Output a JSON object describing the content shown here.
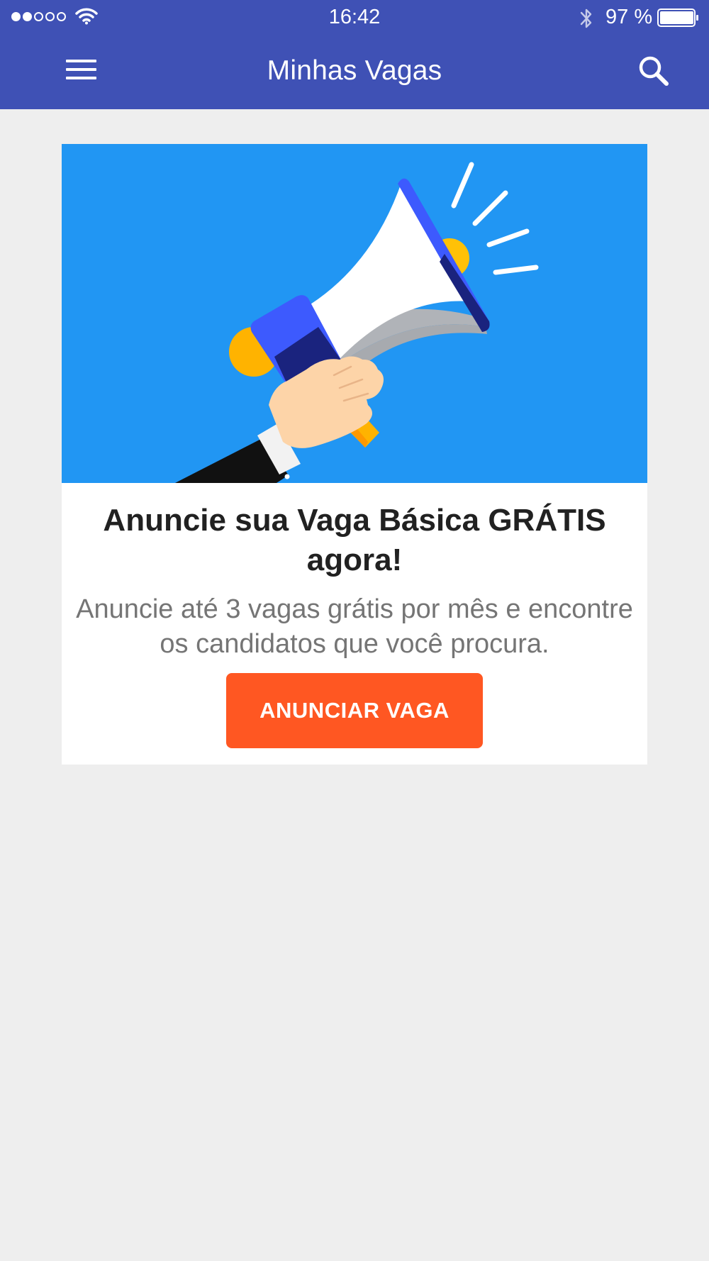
{
  "status_bar": {
    "time": "16:42",
    "battery_percent": "97 %",
    "signal_bars_filled": 2,
    "signal_bars_total": 5,
    "icons": [
      "wifi-icon",
      "bluetooth-icon",
      "battery-icon"
    ]
  },
  "header": {
    "title": "Minhas Vagas",
    "left_icon": "menu-icon",
    "right_icon": "search-icon"
  },
  "promo": {
    "image_icon": "megaphone-illustration",
    "title": "Anuncie sua Vaga Básica GRÁTIS agora!",
    "description": "Anuncie até 3 vagas grátis por mês e encontre os candidatos que você procura.",
    "button_label": "ANUNCIAR VAGA"
  },
  "colors": {
    "app_bar": "#3F51B5",
    "background": "#EEEEEE",
    "promo_image_bg": "#2196F3",
    "cta_button": "#FF5722",
    "title_text": "#212121",
    "body_text": "#757575"
  }
}
